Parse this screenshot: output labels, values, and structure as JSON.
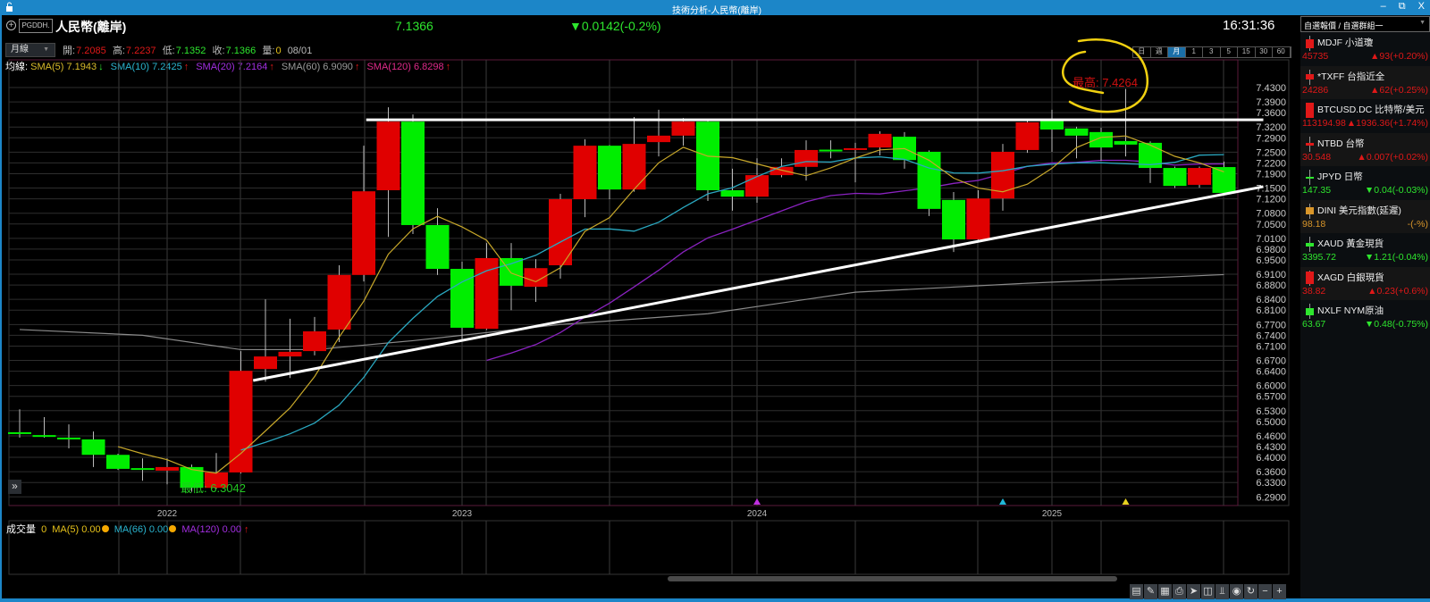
{
  "window": {
    "title": "技術分析-人民幣(離岸)",
    "min": "–",
    "restore": "⧉",
    "close": "X"
  },
  "header": {
    "symbol_code": "PGDDH.",
    "symbol_name": "人民幣(離岸)",
    "last": "7.1366",
    "change": "▼0.0142(-0.2%)",
    "clock": "16:31:36"
  },
  "toolbar": {
    "period": "月線",
    "open_label": "開:",
    "open": "7.2085",
    "high_label": "高:",
    "high": "7.2237",
    "low_label": "低:",
    "low": "7.1352",
    "close_label": "收:",
    "close": "7.1366",
    "vol_label": "量:",
    "vol": "0",
    "date": "08/01",
    "timeframes": [
      "日",
      "週",
      "月",
      "1",
      "3",
      "5",
      "15",
      "30",
      "60"
    ],
    "active_timeframe": "月"
  },
  "ma_row": {
    "label": "均線:",
    "items": [
      {
        "text": "SMA(5) 7.1943",
        "arrow": "↓",
        "color": "#d9bb2a",
        "arrow_color": "#2ee62e"
      },
      {
        "text": "SMA(10) 7.2425",
        "arrow": "↑",
        "color": "#2ab4cf",
        "arrow_color": "#e01818"
      },
      {
        "text": "SMA(20) 7.2164",
        "arrow": "↑",
        "color": "#a22ee0",
        "arrow_color": "#e01818"
      },
      {
        "text": "SMA(60) 6.9090",
        "arrow": "↑",
        "color": "#9a9a9a",
        "arrow_color": "#e01818"
      },
      {
        "text": "SMA(120) 6.8298",
        "arrow": "↑",
        "color": "#e02a8a",
        "arrow_color": "#e01818"
      }
    ]
  },
  "volume": {
    "label": "成交量",
    "value": "0",
    "ma5": "MA(5) 0.00",
    "ma66": "MA(66) 0.00",
    "ma120": "MA(120) 0.00",
    "arrow": "↑"
  },
  "chart_data": {
    "type": "candlestick",
    "interval": "monthly",
    "colors": {
      "up": "#e00000",
      "down": "#00ee00",
      "sma5": "#c8a82a",
      "sma10": "#2aa8c0",
      "sma20": "#8a22c0",
      "sma60": "#8a8a8a"
    },
    "y_ticks": [
      "7.4300",
      "7.3900",
      "7.3600",
      "7.3200",
      "7.2900",
      "7.2500",
      "7.2200",
      "7.1900",
      "7.1500",
      "7.1200",
      "7.0800",
      "7.0500",
      "7.0100",
      "6.9800",
      "6.9500",
      "6.9100",
      "6.8800",
      "6.8400",
      "6.8100",
      "6.7700",
      "6.7400",
      "6.7100",
      "6.6700",
      "6.6400",
      "6.6000",
      "6.5700",
      "6.5300",
      "6.5000",
      "6.4600",
      "6.4300",
      "6.4000",
      "6.3600",
      "6.3300",
      "6.2900"
    ],
    "x_ticks": [
      {
        "label": "2022",
        "index": 6
      },
      {
        "label": "2023",
        "index": 18
      },
      {
        "label": "2024",
        "index": 30
      },
      {
        "label": "2025",
        "index": 42
      }
    ],
    "candles": [
      [
        6.47,
        6.534,
        6.455,
        6.465
      ],
      [
        6.462,
        6.512,
        6.455,
        6.457
      ],
      [
        6.455,
        6.492,
        6.425,
        6.452
      ],
      [
        6.45,
        6.472,
        6.373,
        6.407
      ],
      [
        6.407,
        6.41,
        6.365,
        6.368
      ],
      [
        6.37,
        6.397,
        6.335,
        6.367
      ],
      [
        6.363,
        6.397,
        6.325,
        6.373
      ],
      [
        6.373,
        6.38,
        6.3042,
        6.315
      ],
      [
        6.315,
        6.412,
        6.312,
        6.358
      ],
      [
        6.358,
        6.696,
        6.355,
        6.641
      ],
      [
        6.646,
        6.84,
        6.611,
        6.681
      ],
      [
        6.681,
        6.786,
        6.621,
        6.694
      ],
      [
        6.696,
        6.791,
        6.684,
        6.751
      ],
      [
        6.756,
        6.935,
        6.721,
        6.908
      ],
      [
        6.908,
        7.268,
        6.89,
        7.141
      ],
      [
        7.144,
        7.375,
        7.014,
        7.335
      ],
      [
        7.335,
        7.355,
        7.022,
        7.047
      ],
      [
        7.047,
        7.094,
        6.908,
        6.925
      ],
      [
        6.925,
        6.945,
        6.728,
        6.761
      ],
      [
        6.758,
        6.997,
        6.755,
        6.955
      ],
      [
        6.955,
        6.997,
        6.81,
        6.878
      ],
      [
        6.875,
        6.952,
        6.833,
        6.927
      ],
      [
        6.935,
        7.134,
        6.898,
        7.119
      ],
      [
        7.119,
        7.286,
        7.069,
        7.268
      ],
      [
        7.268,
        7.27,
        7.119,
        7.146
      ],
      [
        7.146,
        7.348,
        7.14,
        7.273
      ],
      [
        7.278,
        7.368,
        7.238,
        7.296
      ],
      [
        7.296,
        7.345,
        7.268,
        7.335
      ],
      [
        7.335,
        7.34,
        7.114,
        7.144
      ],
      [
        7.144,
        7.204,
        7.087,
        7.126
      ],
      [
        7.126,
        7.233,
        7.109,
        7.186
      ],
      [
        7.186,
        7.233,
        7.18,
        7.209
      ],
      [
        7.209,
        7.283,
        7.171,
        7.256
      ],
      [
        7.257,
        7.283,
        7.233,
        7.255
      ],
      [
        7.256,
        7.276,
        7.166,
        7.261
      ],
      [
        7.263,
        7.308,
        7.241,
        7.301
      ],
      [
        7.293,
        7.306,
        7.204,
        7.228
      ],
      [
        7.251,
        7.255,
        7.072,
        7.092
      ],
      [
        7.117,
        7.139,
        6.972,
        7.007
      ],
      [
        7.007,
        7.144,
        7.0,
        7.121
      ],
      [
        7.121,
        7.273,
        7.087,
        7.251
      ],
      [
        7.256,
        7.34,
        7.248,
        7.333
      ],
      [
        7.338,
        7.368,
        7.251,
        7.313
      ],
      [
        7.316,
        7.321,
        7.233,
        7.296
      ],
      [
        7.306,
        7.318,
        7.226,
        7.263
      ],
      [
        7.281,
        7.4264,
        7.238,
        7.271
      ],
      [
        7.276,
        7.28,
        7.164,
        7.206
      ],
      [
        7.206,
        7.21,
        7.15,
        7.156
      ],
      [
        7.159,
        7.21,
        7.151,
        7.206
      ],
      [
        7.2085,
        7.2237,
        7.1352,
        7.1366
      ]
    ],
    "sma60_points": [
      [
        0,
        6.756
      ],
      [
        5,
        6.74
      ],
      [
        9,
        6.7
      ],
      [
        12,
        6.7
      ],
      [
        16,
        6.725
      ],
      [
        22,
        6.77
      ],
      [
        28,
        6.8
      ],
      [
        34,
        6.86
      ],
      [
        41,
        6.885
      ],
      [
        49,
        6.909
      ]
    ],
    "trendlines": [
      {
        "name": "resistance",
        "from": [
          14.1,
          7.34
        ],
        "to": [
          50.6,
          7.34
        ]
      },
      {
        "name": "support",
        "from": [
          9.5,
          6.614
        ],
        "to": [
          50.6,
          7.154
        ]
      }
    ],
    "markers": [
      {
        "index": 30,
        "color": "#c030e0"
      },
      {
        "index": 40,
        "color": "#20b8d8"
      },
      {
        "index": 45,
        "color": "#e8d020"
      }
    ],
    "annotations": {
      "high_label": "最高: 7.4264",
      "low_label": "最低: 6.3042"
    }
  },
  "watchlist": {
    "title": "自選報價 / 自選群組一",
    "items": [
      {
        "name": "MDJF 小道瓊",
        "price": "45735",
        "change": "▲93(+0.20%)",
        "dir": "up"
      },
      {
        "name": "*TXFF 台指近全",
        "price": "24286",
        "change": "▲62(+0.25%)",
        "dir": "up"
      },
      {
        "name": "BTCUSD.DC 比特幣/美元",
        "price": "113194.98",
        "change": "▲1936.36(+1.74%)",
        "dir": "up"
      },
      {
        "name": "NTBD 台幣",
        "price": "30.548",
        "change": "▲0.007(+0.02%)",
        "dir": "up"
      },
      {
        "name": "JPYD 日幣",
        "price": "147.35",
        "change": "▼0.04(-0.03%)",
        "dir": "down"
      },
      {
        "name": "DINI 美元指數(延遲)",
        "price": "98.18",
        "change": "-(-%)",
        "dir": "flat"
      },
      {
        "name": "XAUD 黃金現貨",
        "price": "3395.72",
        "change": "▼1.21(-0.04%)",
        "dir": "down"
      },
      {
        "name": "XAGD 白銀現貨",
        "price": "38.82",
        "change": "▲0.23(+0.6%)",
        "dir": "up"
      },
      {
        "name": "NXLF NYM原油",
        "price": "63.67",
        "change": "▼0.48(-0.75%)",
        "dir": "down"
      }
    ]
  },
  "bottom_tools": [
    "document-icon",
    "draw-line-icon",
    "data-window-icon",
    "print-icon",
    "cursor-icon",
    "layout-icon",
    "indicator-icon",
    "eye-icon",
    "refresh-icon",
    "zoom-out-icon",
    "zoom-in-icon"
  ],
  "expand_label": "»"
}
